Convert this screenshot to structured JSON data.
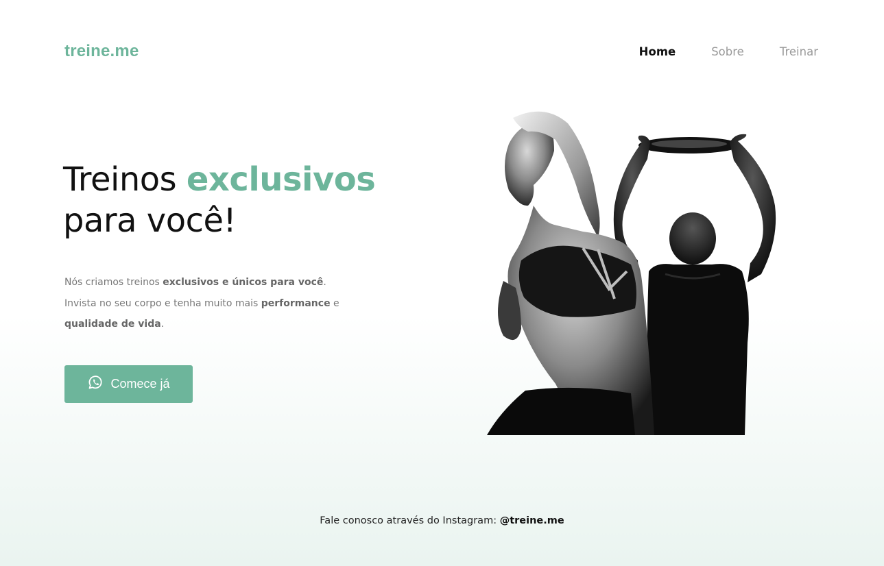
{
  "brand": {
    "name": "treine.me",
    "accent_color": "#6db59b"
  },
  "nav": {
    "items": [
      {
        "label": "Home",
        "active": true
      },
      {
        "label": "Sobre",
        "active": false
      },
      {
        "label": "Treinar",
        "active": false
      }
    ]
  },
  "hero": {
    "title_part1": "Treinos ",
    "title_accent": "exclusivos",
    "title_part2": "para você!",
    "intro": {
      "l1_a": "Nós criamos treinos ",
      "l1_b": "exclusivos e únicos para você",
      "l1_c": ".",
      "l2_a": "Invista no seu corpo e tenha muito mais ",
      "l2_b": "performance",
      "l2_c": " e",
      "l3_b": "qualidade de vida",
      "l3_c": "."
    },
    "cta": {
      "label": "Comece já",
      "icon": "whatsapp-icon"
    },
    "image": {
      "subject": "fitness-athletes-photo"
    }
  },
  "footer": {
    "text": "Fale conosco através do Instagram: ",
    "handle": "@treine.me"
  }
}
